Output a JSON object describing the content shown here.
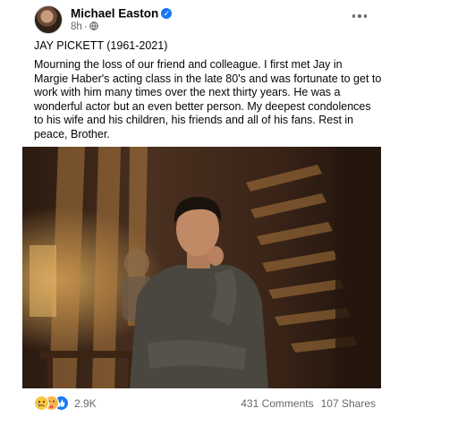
{
  "post": {
    "author": "Michael Easton",
    "time": "8h",
    "separator": "·",
    "title": "JAY PICKETT (1961-2021)",
    "body_lines": [
      "Mourning the loss of our friend and colleague.  I first met Jay in",
      "Margie Haber's acting class in the late 80's and was fortunate to get to",
      "work with him many times over the next thirty years. He was a",
      "wonderful actor but an even better person. My deepest condolences",
      "to his wife and his children, his friends and all of his fans. Rest in",
      "peace, Brother."
    ]
  },
  "icons": {
    "verified": "verified-badge-icon",
    "audience": "globe-icon",
    "more": "more-options-icon",
    "reactions": [
      "sad-reaction-icon",
      "care-reaction-icon",
      "like-reaction-icon"
    ]
  },
  "colors": {
    "text": "#050505",
    "secondary": "#65676b",
    "accent": "#1877f2"
  },
  "footer": {
    "reaction_count": "2.9K",
    "comments": "431 Comments",
    "shares": "107 Shares"
  }
}
